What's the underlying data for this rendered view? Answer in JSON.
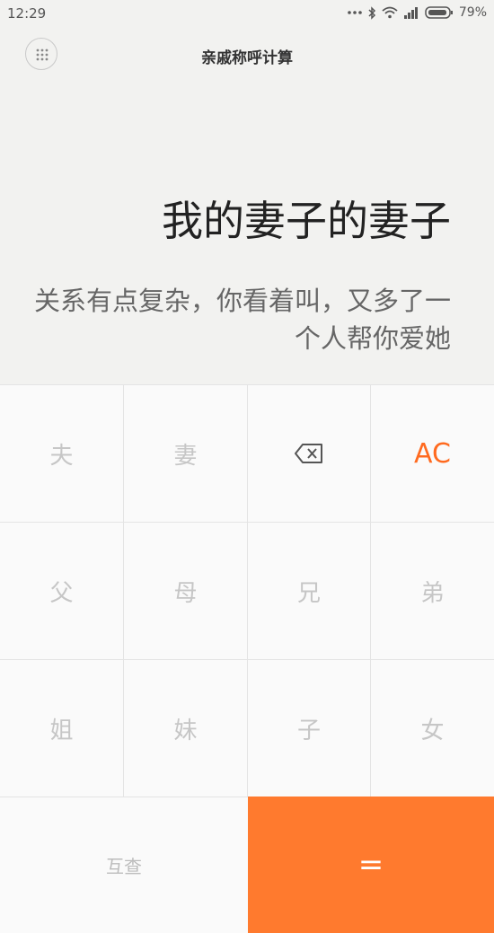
{
  "status_bar": {
    "time": "12:29",
    "battery_percent": "79%",
    "icons": [
      "more-dots-icon",
      "bluetooth-icon",
      "wifi-icon",
      "signal-icon",
      "battery-icon"
    ]
  },
  "header": {
    "title": "亲戚称呼计算",
    "menu_icon": "grid-menu-icon"
  },
  "result": {
    "main": "我的妻子的妻子",
    "sub": "关系有点复杂，你看着叫，又多了一个人帮你爱她"
  },
  "keypad": {
    "row1": [
      "夫",
      "妻",
      "backspace",
      "AC"
    ],
    "row2": [
      "父",
      "母",
      "兄",
      "弟"
    ],
    "row3": [
      "姐",
      "妹",
      "子",
      "女"
    ],
    "swap_label": "互查",
    "equals_label": "="
  },
  "colors": {
    "accent": "#ff7a2e",
    "ac_text": "#ff6a1f",
    "background": "#f2f2f0"
  }
}
